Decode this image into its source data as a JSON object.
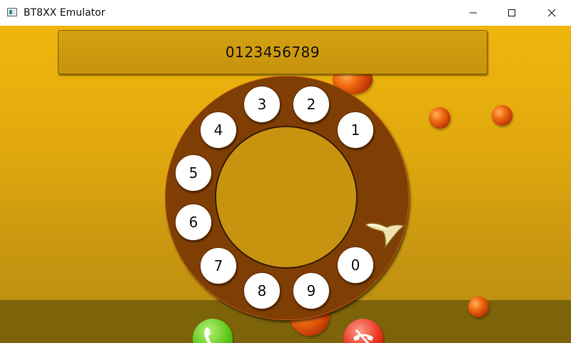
{
  "window": {
    "title": "BT8XX Emulator",
    "icons": {
      "app": "app-window-icon",
      "minimize": "minimize-icon",
      "maximize": "maximize-icon",
      "close": "close-icon"
    }
  },
  "display": {
    "number": "0123456789"
  },
  "dial": {
    "digits": [
      {
        "label": "1"
      },
      {
        "label": "2"
      },
      {
        "label": "3"
      },
      {
        "label": "4"
      },
      {
        "label": "5"
      },
      {
        "label": "6"
      },
      {
        "label": "7"
      },
      {
        "label": "8"
      },
      {
        "label": "9"
      },
      {
        "label": "0"
      }
    ],
    "finger_stop_icon": "finger-stop-icon"
  },
  "actions": {
    "answer_icon": "phone-answer-icon",
    "hangup_icon": "phone-hangup-icon"
  },
  "colors": {
    "background_top": "#f0b60d",
    "dial_ring": "#7f3e04",
    "dial_center": "#c8930f",
    "answer": "#5cc616",
    "hangup": "#e8321c"
  }
}
